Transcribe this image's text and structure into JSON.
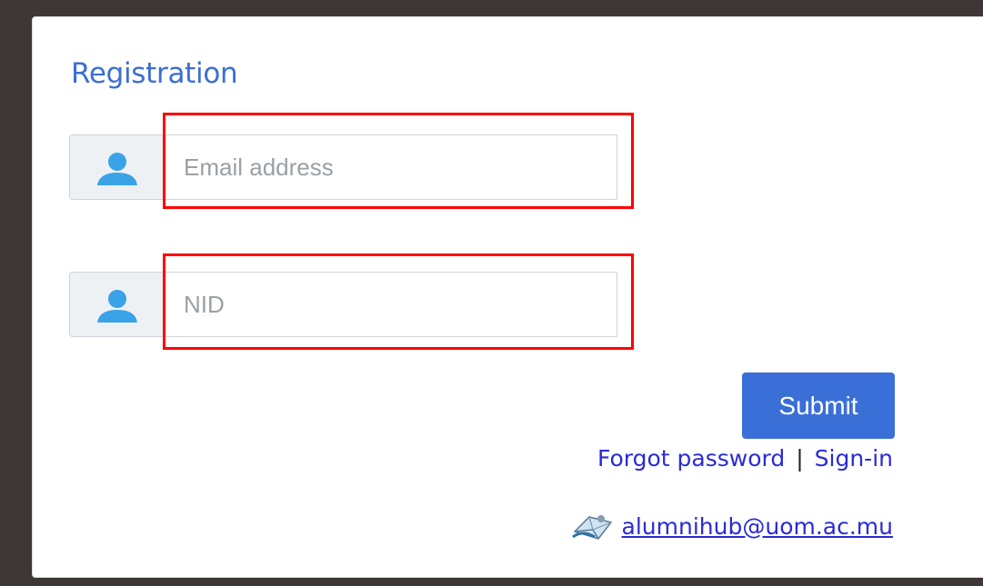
{
  "form": {
    "title": "Registration",
    "email": {
      "value": "",
      "placeholder": "Email address",
      "icon": "user-icon"
    },
    "nid": {
      "value": "",
      "placeholder": "NID",
      "icon": "user-icon"
    },
    "submit_label": "Submit"
  },
  "links": {
    "forgot": "Forgot password",
    "separator": "|",
    "signin": "Sign-in"
  },
  "contact": {
    "email": "alumnihub@uom.ac.mu",
    "icon": "mail-icon"
  },
  "colors": {
    "accent": "#3a6fd8",
    "title": "#3b6fd1",
    "link": "#2b2bd6",
    "highlight": "#ff0000",
    "icon": "#3aa3e8"
  }
}
